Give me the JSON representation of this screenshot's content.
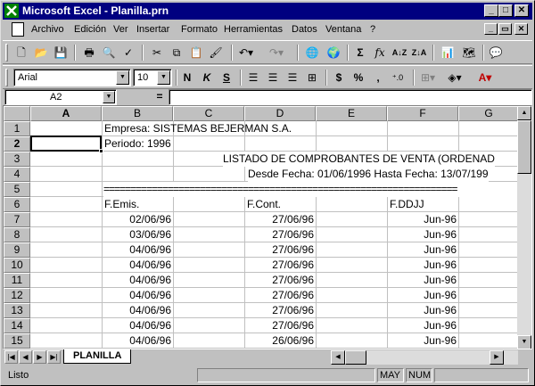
{
  "window": {
    "title": "Microsoft Excel - Planilla.prn"
  },
  "menu": [
    "Archivo",
    "Edición",
    "Ver",
    "Insertar",
    "Formato",
    "Herramientas",
    "Datos",
    "Ventana",
    "?"
  ],
  "font": {
    "name": "Arial",
    "size": "10"
  },
  "namebox": {
    "value": "A2"
  },
  "formula": {
    "eq": "=",
    "value": ""
  },
  "columns": [
    "A",
    "B",
    "C",
    "D",
    "E",
    "F",
    "G"
  ],
  "rows": [
    "1",
    "2",
    "3",
    "4",
    "5",
    "6",
    "7",
    "8",
    "9",
    "10",
    "11",
    "12",
    "13",
    "14",
    "15"
  ],
  "cells": {
    "b1": "Empresa: SISTEMAS BEJERMAN S.A.",
    "b2": "Periodo: 1996",
    "d3": "LISTADO DE COMPROBANTES DE VENTA (ORDENAD",
    "d4": "Desde Fecha: 01/06/1996    Hasta Fecha: 13/07/199",
    "b5": "==================================================================",
    "b6": "F.Emis.",
    "d6": "F.Cont.",
    "f6": "F.DDJJ",
    "data": [
      {
        "emis": "02/06/96",
        "cont": "27/06/96",
        "ddjj": "Jun-96"
      },
      {
        "emis": "03/06/96",
        "cont": "27/06/96",
        "ddjj": "Jun-96"
      },
      {
        "emis": "04/06/96",
        "cont": "27/06/96",
        "ddjj": "Jun-96"
      },
      {
        "emis": "04/06/96",
        "cont": "27/06/96",
        "ddjj": "Jun-96"
      },
      {
        "emis": "04/06/96",
        "cont": "27/06/96",
        "ddjj": "Jun-96"
      },
      {
        "emis": "04/06/96",
        "cont": "27/06/96",
        "ddjj": "Jun-96"
      },
      {
        "emis": "04/06/96",
        "cont": "27/06/96",
        "ddjj": "Jun-96"
      },
      {
        "emis": "04/06/96",
        "cont": "27/06/96",
        "ddjj": "Jun-96"
      },
      {
        "emis": "04/06/96",
        "cont": "26/06/96",
        "ddjj": "Jun-96"
      }
    ]
  },
  "sheet_tab": "PLANILLA",
  "status": {
    "text": "Listo",
    "may": "MAY",
    "num": "NUM"
  },
  "colors": {
    "title_bar": "#000080",
    "face": "#c0c0c0"
  }
}
